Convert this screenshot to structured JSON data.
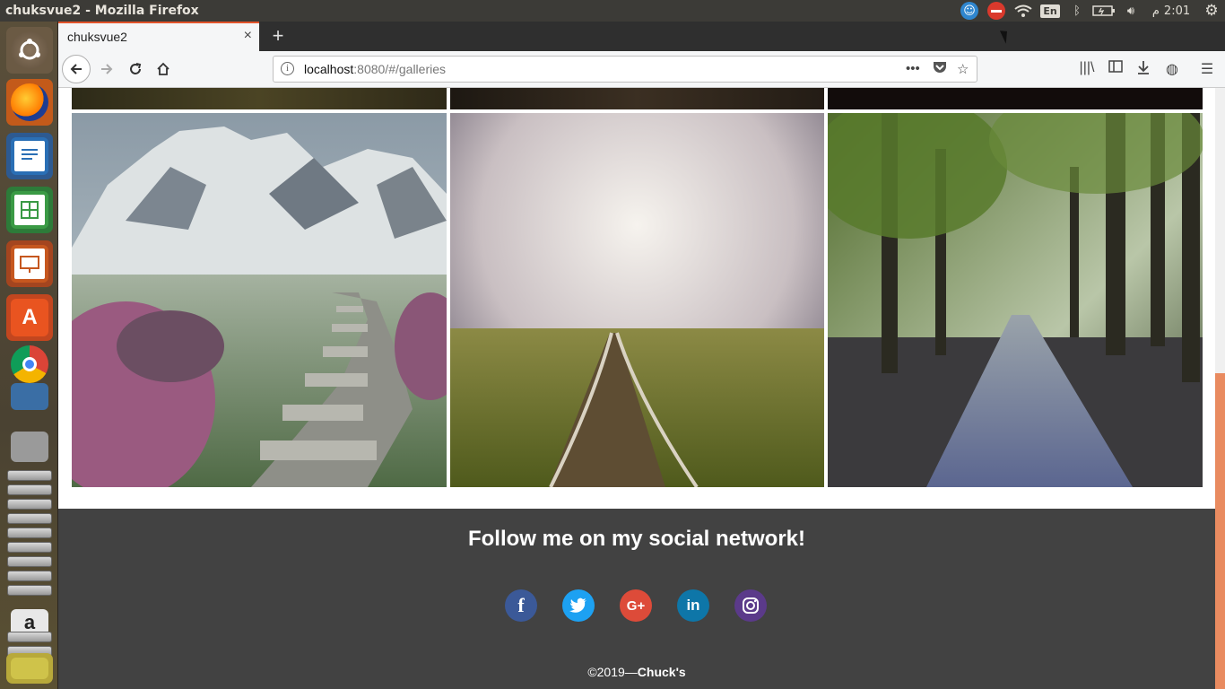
{
  "system": {
    "window_title": "chuksvue2 - Mozilla Firefox",
    "keyboard_layout": "En",
    "clock": "2:01",
    "clock_suffix": "م"
  },
  "launcher": {
    "items": [
      "ubuntu-dash-icon",
      "firefox-icon",
      "libreoffice-writer-icon",
      "libreoffice-calc-icon",
      "libreoffice-impress-icon",
      "ubuntu-software-icon",
      "chrome-icon",
      "editor-icon",
      "files-icon",
      "amazon-icon"
    ]
  },
  "browser": {
    "tab_title": "chuksvue2",
    "url_host": "localhost",
    "url_rest": ":8080/#/galleries",
    "new_tab_symbol": "+",
    "close_symbol": "×"
  },
  "gallery": {
    "images": [
      {
        "alt": "mountain-stone-path"
      },
      {
        "alt": "railway-track-fog"
      },
      {
        "alt": "forest-road-sunbeams"
      }
    ]
  },
  "footer": {
    "heading": "Follow me on my social network!",
    "socials": [
      {
        "name": "facebook",
        "glyph": "f",
        "color": "#3b5998"
      },
      {
        "name": "twitter",
        "glyph": "t",
        "color": "#1da1f2"
      },
      {
        "name": "google-plus",
        "glyph": "G+",
        "color": "#dd4b39"
      },
      {
        "name": "linkedin",
        "glyph": "in",
        "color": "#0e76a8"
      },
      {
        "name": "instagram",
        "glyph": "◎",
        "color": "#5b3a8a"
      }
    ],
    "copyright_prefix": "©2019—",
    "copyright_name": "Chuck's"
  }
}
